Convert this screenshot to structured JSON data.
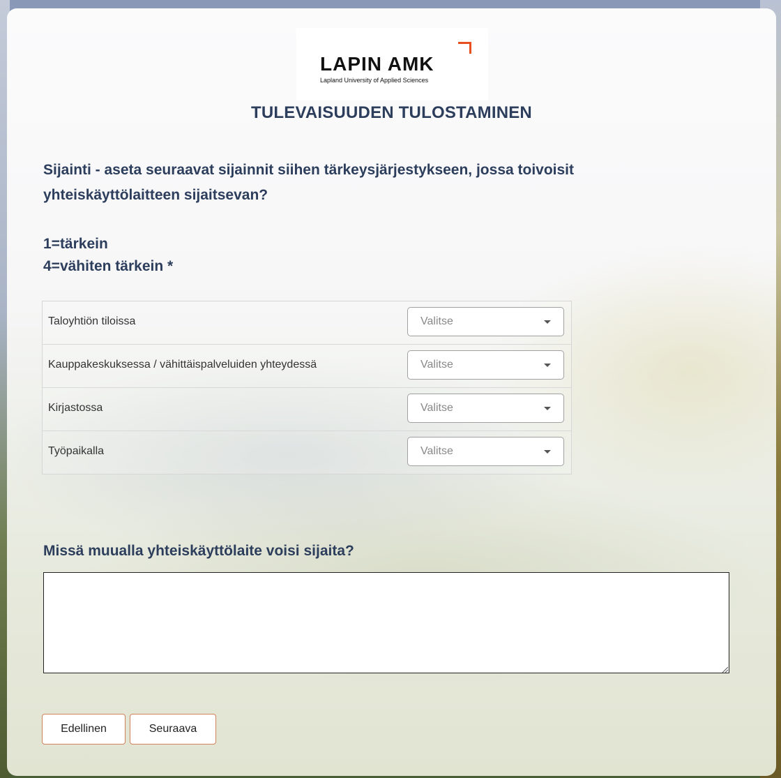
{
  "logo": {
    "name": "LAPIN AMK",
    "subtitle": "Lapland University of Applied Sciences",
    "accent_color": "#e8501f"
  },
  "page": {
    "title": "TULEVAISUUDEN TULOSTAMINEN"
  },
  "question_1": {
    "line_1": "Sijainti - aseta seuraavat sijainnit siihen tärkeysjärjestykseen, jossa toivoisit",
    "line_2": "yhteiskäyttölaitteen sijaitsevan?",
    "scale_top": "1=tärkein",
    "scale_bottom": "4=vähiten tärkein *",
    "rows": [
      {
        "label": "Taloyhtiön tiloissa",
        "value": "Valitse"
      },
      {
        "label": "Kauppakeskuksessa / vähittäispalveluiden yhteydessä",
        "value": "Valitse"
      },
      {
        "label": "Kirjastossa",
        "value": "Valitse"
      },
      {
        "label": "Työpaikalla",
        "value": "Valitse"
      }
    ]
  },
  "question_2": {
    "text": "Missä muualla yhteiskäyttölaite voisi sijaita?",
    "answer_value": ""
  },
  "navigation": {
    "previous_label": "Edellinen",
    "next_label": "Seuraava"
  },
  "colors": {
    "heading": "#2c3e5c",
    "button_border": "#d0825a"
  }
}
